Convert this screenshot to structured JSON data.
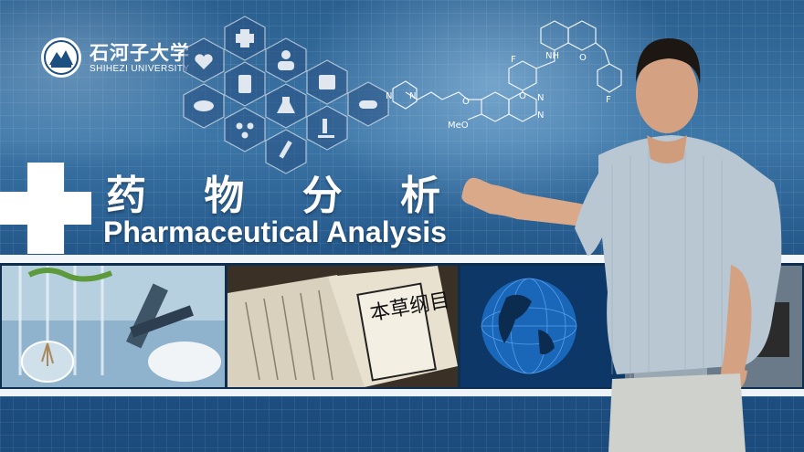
{
  "branding": {
    "university_cn": "石河子大学",
    "university_en": "SHIHEZI UNIVERSITY"
  },
  "title": {
    "chinese": "药 物 分 析",
    "english": "Pharmaceutical Analysis"
  },
  "molecule_labels": {
    "nh": "NH",
    "methoxy": "MeO",
    "fluoro_top": "F",
    "fluoro_bottom": "F",
    "oxygen_1": "O",
    "oxygen_2": "O",
    "oxygen_carbonyl": "O",
    "nitrogen_ring": "N",
    "nitrogen_a": "N",
    "nitrogen_b": "N",
    "nitrogen_c": "N"
  },
  "book_text": "本草纲目",
  "colors": {
    "background": "#2a5f8f",
    "title_text": "#ffffff",
    "band": "#f4f7fa"
  },
  "icons": [
    "medical-cross-icon",
    "heart-icon",
    "person-icon",
    "medicine-box-icon",
    "flask-icon",
    "eye-icon",
    "molecule-icon",
    "clipboard-icon",
    "pill-icon",
    "microscope-icon"
  ]
}
